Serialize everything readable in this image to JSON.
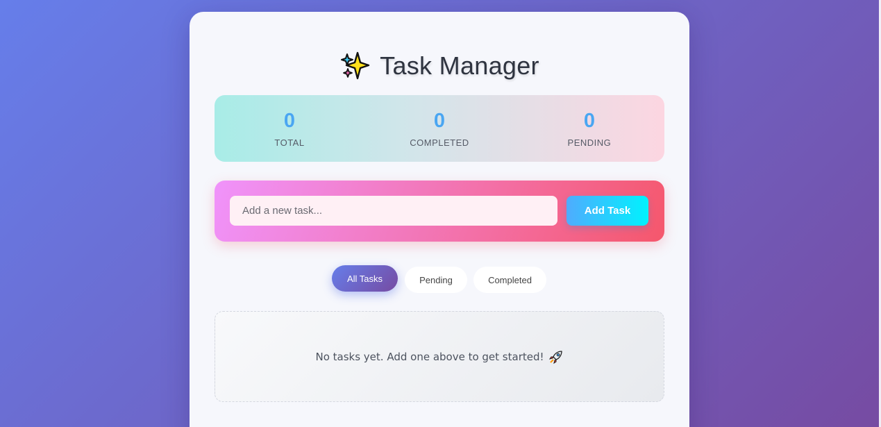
{
  "header": {
    "icon": "sparkles-icon",
    "title": "Task Manager"
  },
  "stats": [
    {
      "value": "0",
      "label": "TOTAL"
    },
    {
      "value": "0",
      "label": "COMPLETED"
    },
    {
      "value": "0",
      "label": "PENDING"
    }
  ],
  "new_task": {
    "value": "",
    "placeholder": "Add a new task...",
    "button_label": "Add Task"
  },
  "filters": {
    "all_label": "All Tasks",
    "pending_label": "Pending",
    "completed_label": "Completed",
    "active": "All Tasks"
  },
  "empty_state": {
    "text": "No tasks yet. Add one above to get started!",
    "icon": "rocket-icon"
  },
  "colors": {
    "background_start": "#667eea",
    "background_end": "#764ba2",
    "stat_value": "#4aa6f2",
    "input_panel_start": "#f093fb",
    "input_panel_end": "#f5576c",
    "add_button_start": "#4facfe",
    "add_button_end": "#00f2fe"
  }
}
